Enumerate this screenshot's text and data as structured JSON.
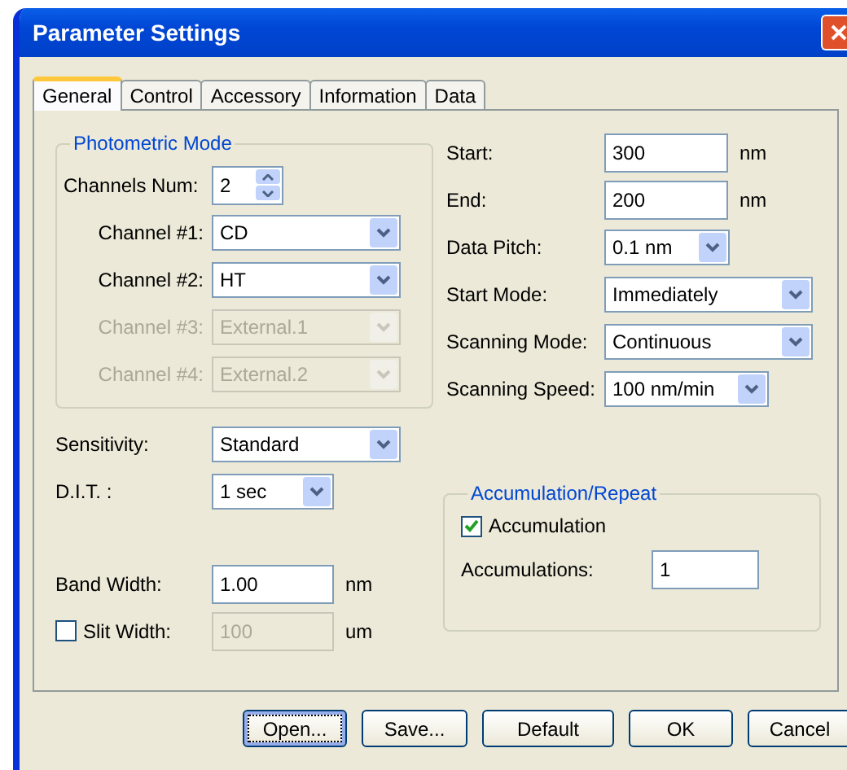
{
  "window": {
    "title": "Parameter Settings"
  },
  "tabs": [
    {
      "label": "General",
      "selected": true
    },
    {
      "label": "Control",
      "selected": false
    },
    {
      "label": "Accessory",
      "selected": false
    },
    {
      "label": "Information",
      "selected": false
    },
    {
      "label": "Data",
      "selected": false
    }
  ],
  "photometric_mode": {
    "title": "Photometric Mode",
    "fields": [
      {
        "kind": "spin",
        "label": "Channels Num:",
        "value": "2"
      },
      {
        "kind": "combo",
        "label": "Channel #1:",
        "value": "CD",
        "disabled": false
      },
      {
        "kind": "combo",
        "label": "Channel #2:",
        "value": "HT",
        "disabled": false
      },
      {
        "kind": "combo",
        "label": "Channel #3:",
        "value": "External.1",
        "disabled": true
      },
      {
        "kind": "combo",
        "label": "Channel #4:",
        "value": "External.2",
        "disabled": true
      }
    ]
  },
  "left_fields": [
    {
      "kind": "combo",
      "label": "Sensitivity:",
      "value": "Standard",
      "disabled": false
    },
    {
      "kind": "combo",
      "label": "D.I.T. :",
      "value": "1 sec",
      "disabled": false
    },
    {
      "kind": "gap"
    },
    {
      "kind": "text",
      "label": "Band Width:",
      "value": "1.00",
      "unit": "nm",
      "disabled": false
    },
    {
      "kind": "checktext",
      "label": "Slit Width:",
      "checked": false,
      "value": "100",
      "unit": "um",
      "disabled": true
    }
  ],
  "scan_fields": [
    {
      "kind": "text",
      "label": "Start:",
      "value": "300",
      "unit": "nm",
      "disabled": false
    },
    {
      "kind": "text",
      "label": "End:",
      "value": "200",
      "unit": "nm",
      "disabled": false
    },
    {
      "kind": "combo",
      "label": "Data Pitch:",
      "value": "0.1 nm",
      "disabled": false
    },
    {
      "kind": "combo",
      "label": "Start Mode:",
      "value": "Immediately",
      "disabled": false
    },
    {
      "kind": "combo",
      "label": "Scanning Mode:",
      "value": "Continuous",
      "disabled": false
    },
    {
      "kind": "combo",
      "label": "Scanning Speed:",
      "value": "100 nm/min",
      "disabled": false
    }
  ],
  "accumulation": {
    "title": "Accumulation/Repeat",
    "checkbox": {
      "label": "Accumulation",
      "checked": true
    },
    "count": {
      "label": "Accumulations:",
      "value": "1"
    }
  },
  "buttons": [
    {
      "label": "Open...",
      "focused": true
    },
    {
      "label": "Save...",
      "focused": false
    },
    {
      "label": "Default",
      "focused": false
    },
    {
      "label": "OK",
      "focused": false
    },
    {
      "label": "Cancel",
      "focused": false
    }
  ]
}
